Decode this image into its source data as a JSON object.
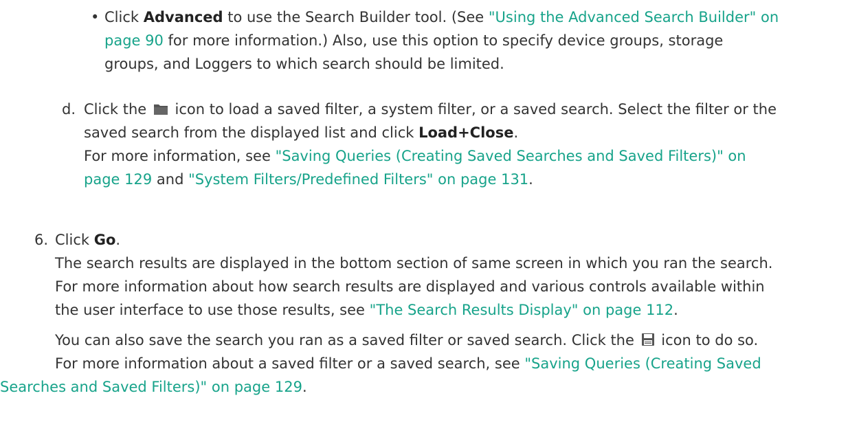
{
  "advanced_item": {
    "prefix": "Click ",
    "bold": "Advanced",
    "text1": " to use the Search Builder tool. (See ",
    "link1_a": "\"Using the Advanced Search Builder\" on",
    "link1_b": "page 90",
    "text2": " for more information.) Also, use this option to specify device groups, storage",
    "text3": "groups, and Loggers to which search should be limited."
  },
  "step_d": {
    "marker": "d.",
    "prefix": "Click the ",
    "icon": "folder-icon",
    "text1": " icon to load a saved filter, a system filter, or a saved search. Select the filter or the",
    "text2": "saved search from the displayed list and click ",
    "bold": "Load+Close",
    "period": ".",
    "more_prefix": "For more information, see ",
    "link1_a": "\"Saving Queries (Creating Saved Searches and Saved Filters)\" on",
    "link1_b": "page 129",
    "and": " and ",
    "link2": "\"System Filters/Predefined Filters\" on page 131",
    "end": "."
  },
  "step_6": {
    "marker": "6.",
    "prefix": "Click ",
    "bold": "Go",
    "period": ".",
    "para1_l1": "The search results are displayed in the bottom section of same screen in which you ran the search.",
    "para1_l2": "For more information about how search results are displayed and various controls available within",
    "para1_l3": "the user interface to use those results, see ",
    "link1": "\"The Search Results Display\" on page 112",
    "end1": ".",
    "para2_l1a": "You can also save the search you ran as a saved filter or saved search. Click the ",
    "icon": "save-icon",
    "para2_l1b": " icon to do so.",
    "para2_l2a": "For more information about a saved filter or a saved search, see ",
    "link2_a": "\"Saving Queries (Creating Saved",
    "link2_b": "Searches and Saved Filters)\" on page 129",
    "end2": "."
  },
  "colors": {
    "text": "#333333",
    "link": "#17a38a",
    "icon": "#555555"
  }
}
